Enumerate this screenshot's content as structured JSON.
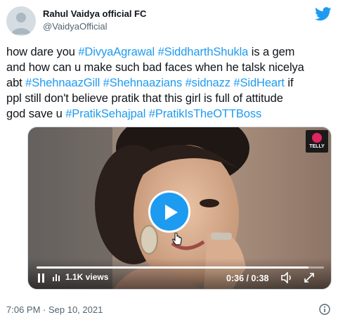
{
  "author": {
    "name": "Rahul Vaidya official FC",
    "handle": "@VaidyaOfficial"
  },
  "tweet": {
    "lines": [
      [
        {
          "text": "how dare you ",
          "kind": "plain"
        },
        {
          "text": "#DivyaAgrawal",
          "kind": "hashtag"
        },
        {
          "text": "  ",
          "kind": "plain"
        },
        {
          "text": "#SiddharthShukla",
          "kind": "hashtag"
        },
        {
          "text": "  is a gem",
          "kind": "plain"
        }
      ],
      [
        {
          "text": "and how can u make such bad faces when he talsk nicelya",
          "kind": "plain"
        }
      ],
      [
        {
          "text": "abt ",
          "kind": "plain"
        },
        {
          "text": "#ShehnaazGill",
          "kind": "hashtag"
        },
        {
          "text": " ",
          "kind": "plain"
        },
        {
          "text": "#Shehnaazians",
          "kind": "hashtag"
        },
        {
          "text": " ",
          "kind": "plain"
        },
        {
          "text": "#sidnazz",
          "kind": "hashtag"
        },
        {
          "text": " ",
          "kind": "plain"
        },
        {
          "text": "#SidHeart",
          "kind": "hashtag"
        },
        {
          "text": " if",
          "kind": "plain"
        }
      ],
      [
        {
          "text": "ppl still don't believe pratik that this girl is full of attitude",
          "kind": "plain"
        }
      ],
      [
        {
          "text": "god save u ",
          "kind": "plain"
        },
        {
          "text": "#PratikSehajpal",
          "kind": "hashtag"
        },
        {
          "text": " ",
          "kind": "plain"
        },
        {
          "text": "#PratikIsTheOTTBoss",
          "kind": "hashtag"
        }
      ]
    ]
  },
  "video": {
    "logo_text": "TELLY",
    "views": "1.1K views",
    "time": "0:36 / 0:38",
    "progress": 0.947
  },
  "footer": {
    "timestamp": "7:06 PM · Sep 10, 2021"
  },
  "colors": {
    "accent": "#1d9bf0",
    "text": "#0f1419",
    "muted": "#536471"
  },
  "icons": [
    "twitter-bird-icon",
    "play-icon",
    "pause-icon",
    "views-icon",
    "volume-icon",
    "fullscreen-icon",
    "info-icon",
    "cursor-icon"
  ]
}
